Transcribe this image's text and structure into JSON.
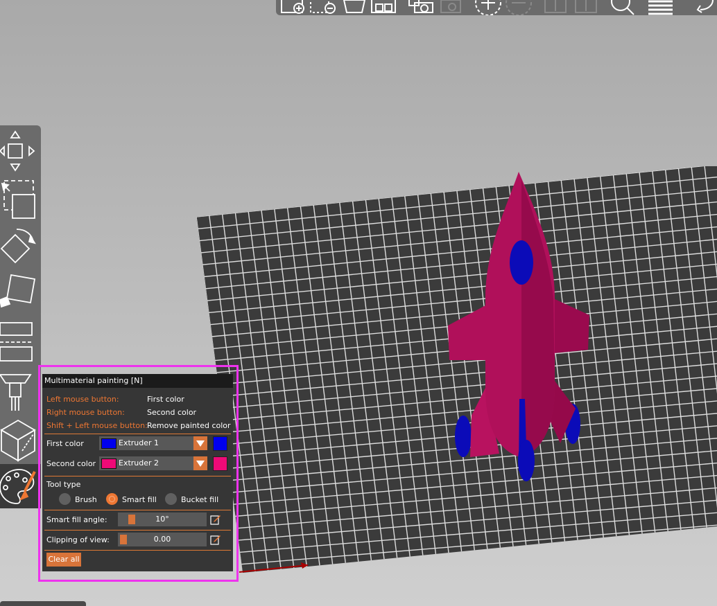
{
  "top_toolbar": {
    "icons": [
      "add-object-icon",
      "delete-object-icon",
      "delete-all-icon",
      "arrange-icon",
      "copy-icon",
      "paste-icon",
      "add-instance-icon",
      "remove-instance-icon",
      "split-objects-icon",
      "split-parts-icon",
      "search-icon",
      "layers-icon",
      "undo-icon"
    ]
  },
  "left_toolbar": {
    "tools": [
      "move-tool",
      "scale-tool",
      "rotate-tool",
      "place-on-face-tool",
      "cut-tool",
      "support-painting-tool",
      "seam-painting-tool",
      "multimaterial-painting-tool"
    ],
    "active": "multimaterial-painting-tool"
  },
  "panel": {
    "title": "Multimaterial painting [N]",
    "hints": [
      {
        "action": "Left mouse button:",
        "effect": "First color"
      },
      {
        "action": "Right mouse button:",
        "effect": "Second color"
      },
      {
        "action": "Shift + Left mouse button:",
        "effect": "Remove painted color"
      }
    ],
    "first_color": {
      "label": "First color",
      "value": "Extruder 1",
      "color": "#0000ee"
    },
    "second_color": {
      "label": "Second color",
      "value": "Extruder 2",
      "color": "#ee0a77"
    },
    "tool_type": {
      "label": "Tool type",
      "options": [
        "Brush",
        "Smart fill",
        "Bucket fill"
      ],
      "selected": "Smart fill"
    },
    "smart_fill_angle": {
      "label": "Smart fill angle:",
      "value": "10°",
      "fraction": 0.111
    },
    "clipping_of_view": {
      "label": "Clipping of view:",
      "value": "0.00",
      "fraction": 0.0
    },
    "clear_label": "Clear all"
  },
  "colors": {
    "accent": "#ee7733",
    "highlight": "#ee33ee",
    "model_body": "#b0105a",
    "model_paint": "#0a0ab0"
  }
}
